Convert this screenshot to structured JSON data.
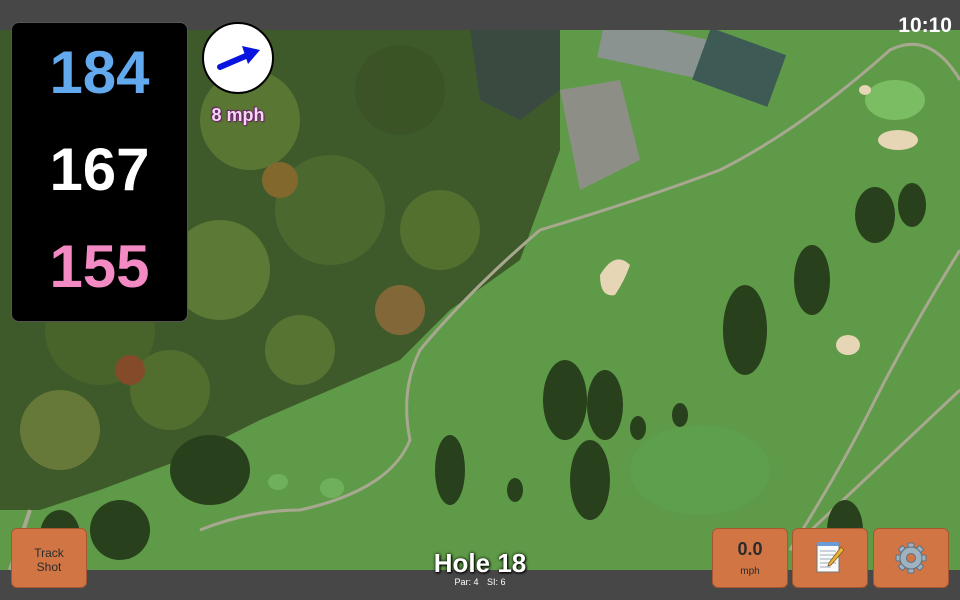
{
  "status_bar": {
    "time": "10:10"
  },
  "distances": {
    "back": "184",
    "middle": "167",
    "front": "155"
  },
  "wind": {
    "speed": "8 mph",
    "direction_icon": "arrow-east-northeast"
  },
  "hole": {
    "title": "Hole 18",
    "par": "Par: 4",
    "stroke_index": "SI: 6"
  },
  "buttons": {
    "track_shot_line1": "Track",
    "track_shot_line2": "Shot",
    "speed_value": "0.0",
    "speed_unit": "mph",
    "notes_icon": "notepad-pencil-icon",
    "settings_icon": "gear-icon"
  },
  "colors": {
    "back_distance": "#63a9ee",
    "middle_distance": "#ffffff",
    "front_distance": "#f48ac4",
    "button": "#d27545",
    "bar": "#474747"
  }
}
